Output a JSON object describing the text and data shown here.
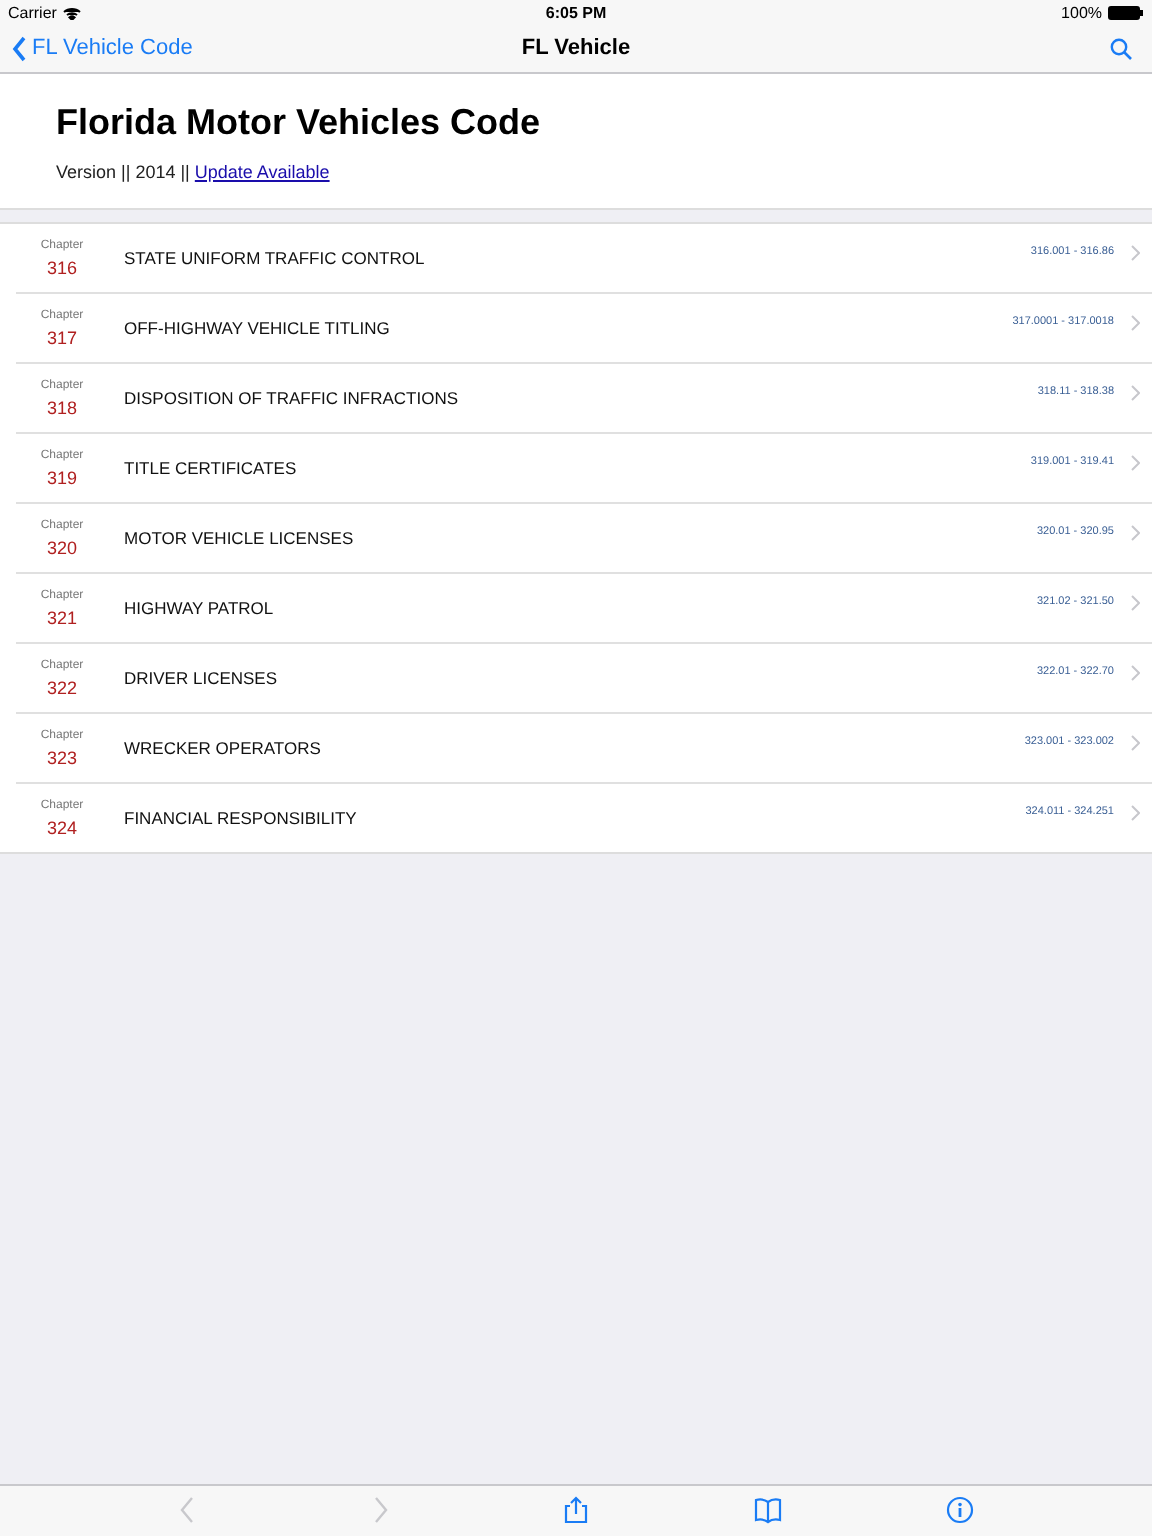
{
  "status_bar": {
    "carrier": "Carrier",
    "time": "6:05 PM",
    "battery": "100%"
  },
  "nav_bar": {
    "back": "FL Vehicle Code",
    "title": "FL Vehicle"
  },
  "header": {
    "title": "Florida Motor Vehicles Code",
    "version": "Version || 2014 ||",
    "link": "Update Available"
  },
  "chapters": [
    {
      "label": "Chapter",
      "number": "316",
      "title": "STATE UNIFORM TRAFFIC CONTROL",
      "range": "316.001 - 316.86"
    },
    {
      "label": "Chapter",
      "number": "317",
      "title": "OFF-HIGHWAY VEHICLE TITLING",
      "range": "317.0001 - 317.0018"
    },
    {
      "label": "Chapter",
      "number": "318",
      "title": "DISPOSITION OF TRAFFIC INFRACTIONS",
      "range": "318.11 - 318.38"
    },
    {
      "label": "Chapter",
      "number": "319",
      "title": "TITLE CERTIFICATES",
      "range": "319.001 - 319.41"
    },
    {
      "label": "Chapter",
      "number": "320",
      "title": "MOTOR VEHICLE LICENSES",
      "range": "320.01 - 320.95"
    },
    {
      "label": "Chapter",
      "number": "321",
      "title": "HIGHWAY PATROL",
      "range": "321.02 - 321.50"
    },
    {
      "label": "Chapter",
      "number": "322",
      "title": "DRIVER LICENSES",
      "range": "322.01 - 322.70"
    },
    {
      "label": "Chapter",
      "number": "323",
      "title": "WRECKER OPERATORS",
      "range": "323.001 - 323.002"
    },
    {
      "label": "Chapter",
      "number": "324",
      "title": "FINANCIAL RESPONSIBILITY",
      "range": "324.011 - 324.251"
    }
  ],
  "toolbar": [
    {
      "kind": "back",
      "disabled": true
    },
    {
      "kind": "forward",
      "disabled": true
    },
    {
      "kind": "share",
      "disabled": false
    },
    {
      "kind": "book",
      "disabled": false
    },
    {
      "kind": "info",
      "disabled": false
    }
  ]
}
